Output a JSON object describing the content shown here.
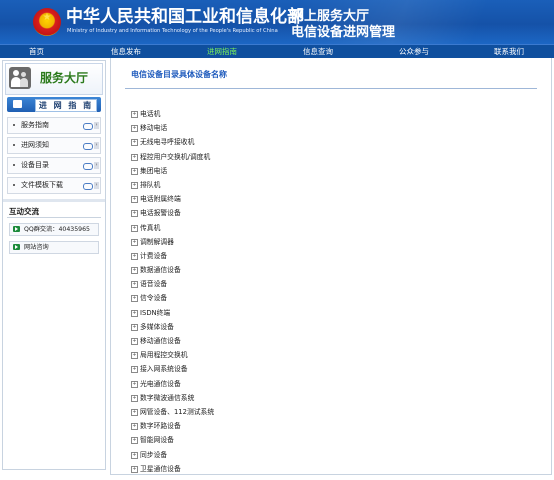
{
  "header": {
    "ministry_cn": "中华人民共和国工业和信息化部",
    "ministry_en": "Ministry of Industry and Information Technology of the People's Republic of China",
    "hall_line1": "网上服务大厅",
    "hall_line2": "电信设备进网管理",
    "colors": {
      "banner": "#1a5fb9",
      "nav": "#0f4f9e",
      "nav_active": "#7cf35a"
    }
  },
  "nav": {
    "items": [
      {
        "label": "首页"
      },
      {
        "label": "信息发布"
      },
      {
        "label": "进网指南",
        "active": true
      },
      {
        "label": "信息查询"
      },
      {
        "label": "公众参与"
      },
      {
        "label": "联系我们"
      }
    ]
  },
  "sidebar": {
    "service_title": "服务大厅",
    "guide_heading": "进 网 指 南",
    "guide_items": [
      {
        "label": "服务指南"
      },
      {
        "label": "进网须知"
      },
      {
        "label": "设备目录"
      },
      {
        "label": "文件模板下载"
      }
    ],
    "exchange_title": "互动交流",
    "exchange_items": [
      {
        "label": "QQ群交流：40435965"
      },
      {
        "label": "网站咨询"
      }
    ]
  },
  "content": {
    "title": "电信设备目录具体设备名称",
    "expander_symbol": "+",
    "tree": [
      "电话机",
      "移动电话",
      "无线电寻呼接收机",
      "程控用户交换机/调度机",
      "集团电话",
      "排队机",
      "电话附属终端",
      "电话报警设备",
      "传真机",
      "调制解调器",
      "计费设备",
      "数据通信设备",
      "语音设备",
      "信令设备",
      "ISDN终端",
      "多媒体设备",
      "移动通信设备",
      "局用程控交换机",
      "接入网系统设备",
      "光电通信设备",
      "数字微波通信系统",
      "网管设备、112测试系统",
      "数字环路设备",
      "智能网设备",
      "同步设备",
      "卫星通信设备"
    ]
  }
}
